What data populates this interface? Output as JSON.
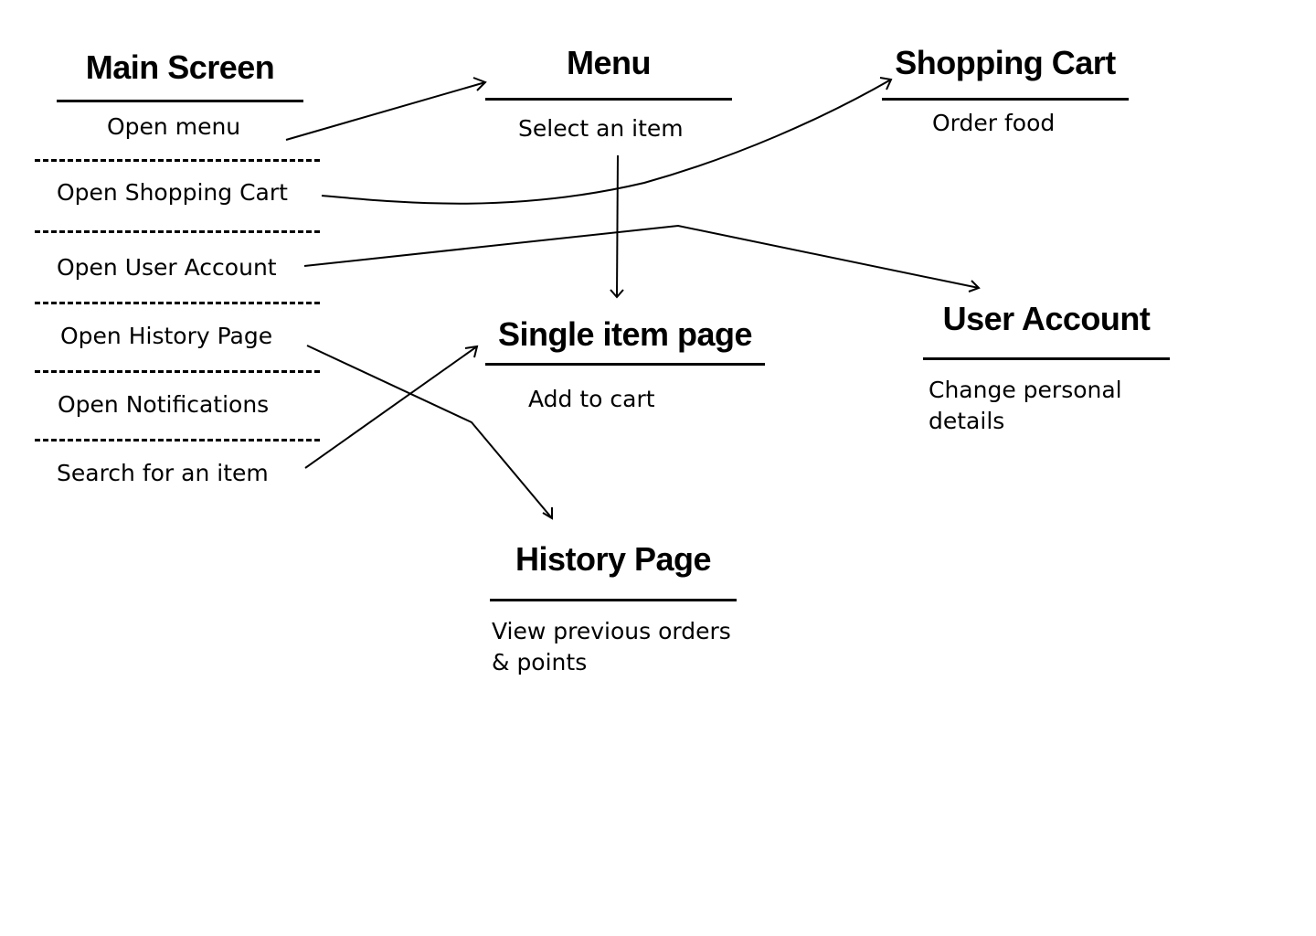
{
  "nodes": {
    "main_screen": {
      "title": "Main Screen",
      "actions": [
        "Open menu",
        "Open Shopping Cart",
        "Open User Account",
        "Open History Page",
        "Open Notifications",
        "Search for an item"
      ]
    },
    "menu": {
      "title": "Menu",
      "action": "Select an item"
    },
    "shopping_cart": {
      "title": "Shopping Cart",
      "action": "Order food"
    },
    "single_item_page": {
      "title": "Single item page",
      "action": "Add to cart"
    },
    "user_account": {
      "title": "User Account",
      "action_line1": "Change personal",
      "action_line2": "details"
    },
    "history_page": {
      "title": "History Page",
      "action_line1": "View previous orders",
      "action_line2": "& points"
    }
  },
  "connections": [
    {
      "from": "Open menu",
      "to": "Menu"
    },
    {
      "from": "Open Shopping Cart",
      "to": "Shopping Cart"
    },
    {
      "from": "Open User Account",
      "to": "User Account"
    },
    {
      "from": "Open History Page",
      "to": "History Page"
    },
    {
      "from": "Search for an item",
      "to": "Single item page"
    },
    {
      "from": "Select an item",
      "to": "Single item page"
    }
  ],
  "colors": {
    "background": "#ffffff",
    "ink": "#000000"
  }
}
